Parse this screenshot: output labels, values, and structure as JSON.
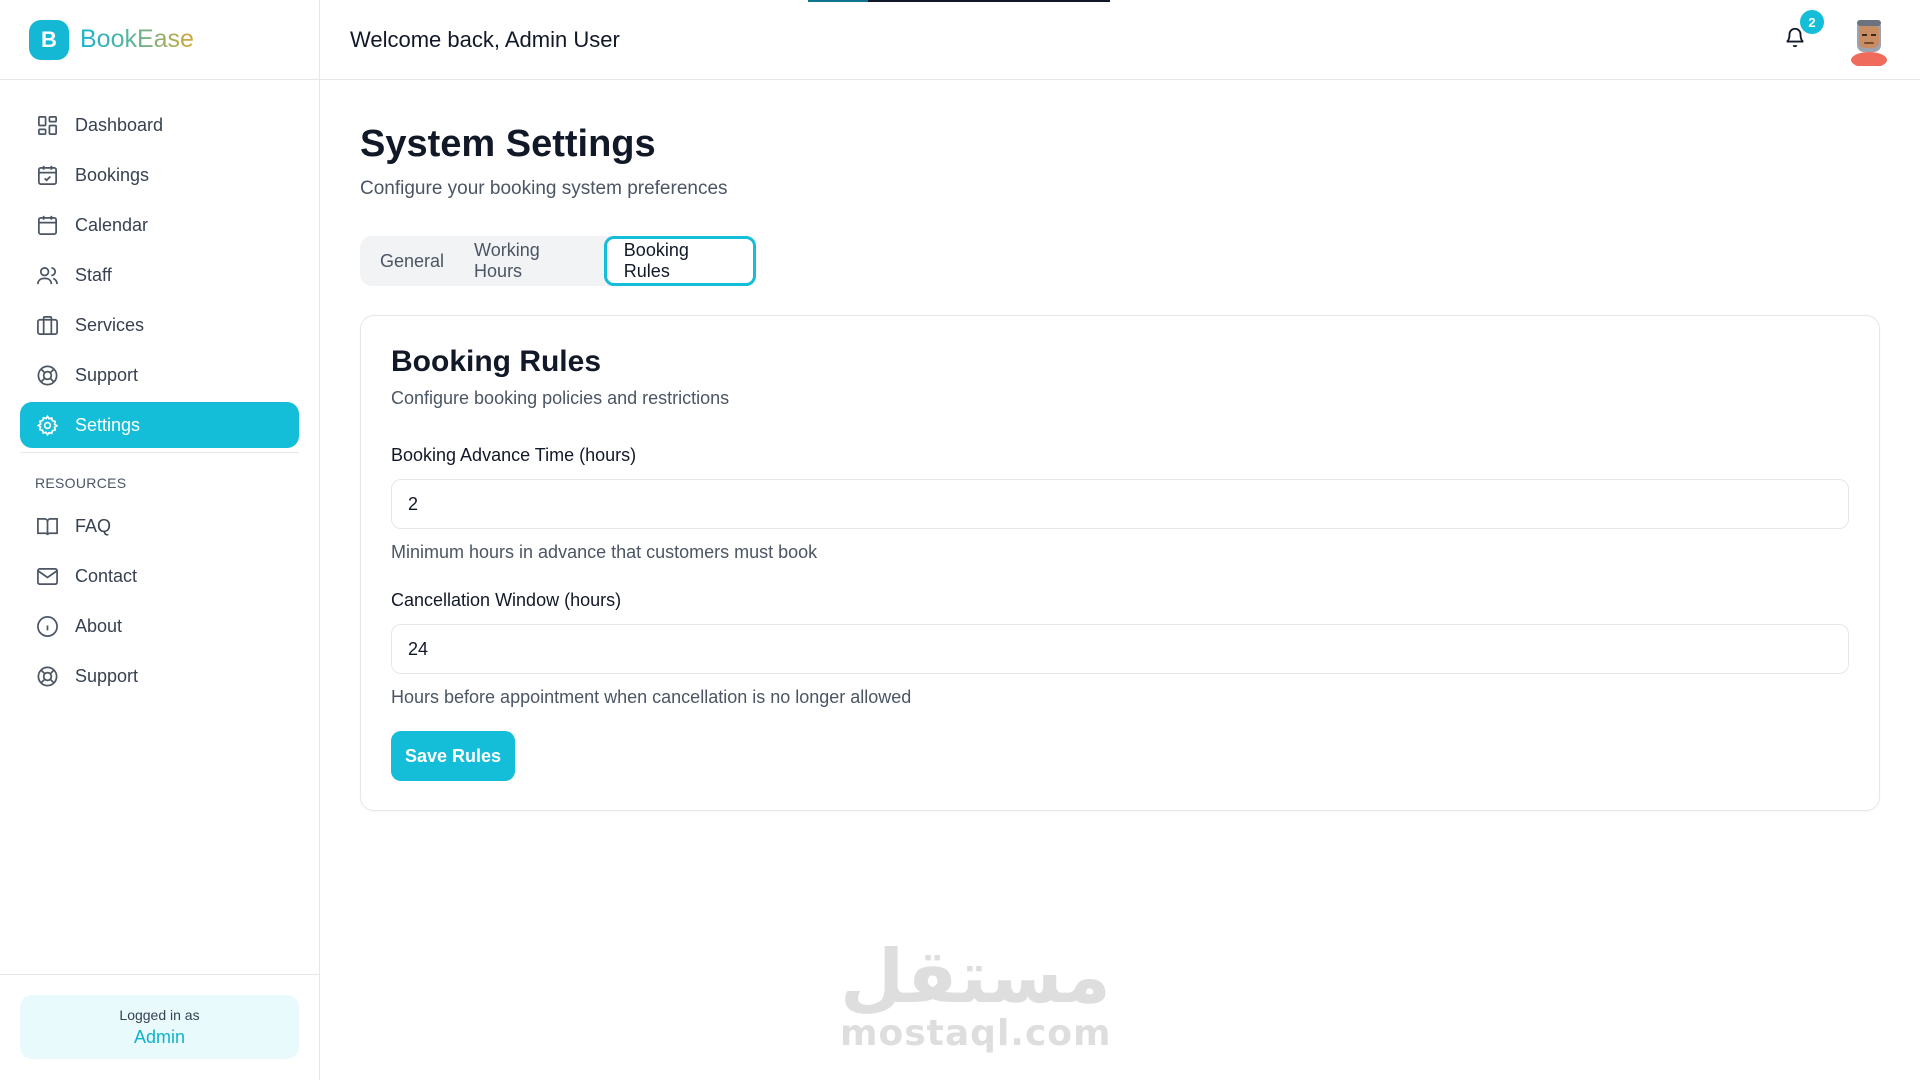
{
  "brand": {
    "logo_letter": "B",
    "name": "BookEase"
  },
  "header": {
    "welcome": "Welcome back, Admin User",
    "notification_count": "2",
    "accent": "#14bdd8"
  },
  "sidebar": {
    "items": [
      {
        "label": "Dashboard",
        "icon": "dashboard-icon"
      },
      {
        "label": "Bookings",
        "icon": "calendar-check-icon"
      },
      {
        "label": "Calendar",
        "icon": "calendar-icon"
      },
      {
        "label": "Staff",
        "icon": "users-icon"
      },
      {
        "label": "Services",
        "icon": "briefcase-icon"
      },
      {
        "label": "Support",
        "icon": "lifebuoy-icon"
      },
      {
        "label": "Settings",
        "icon": "gear-icon",
        "active": true
      }
    ],
    "resources_label": "RESOURCES",
    "resources": [
      {
        "label": "FAQ",
        "icon": "book-open-icon"
      },
      {
        "label": "Contact",
        "icon": "mail-icon"
      },
      {
        "label": "About",
        "icon": "info-icon"
      },
      {
        "label": "Support",
        "icon": "lifebuoy-icon"
      }
    ],
    "footer": {
      "logged_in_label": "Logged in as",
      "user": "Admin"
    }
  },
  "main": {
    "title": "System Settings",
    "subtitle": "Configure your booking system preferences",
    "tabs": [
      {
        "label": "General"
      },
      {
        "label": "Working Hours"
      },
      {
        "label": "Booking Rules",
        "active": true
      }
    ],
    "card": {
      "title": "Booking Rules",
      "subtitle": "Configure booking policies and restrictions",
      "fields": [
        {
          "label": "Booking Advance Time (hours)",
          "value": "2",
          "help": "Minimum hours in advance that customers must book"
        },
        {
          "label": "Cancellation Window (hours)",
          "value": "24",
          "help": "Hours before appointment when cancellation is no longer allowed"
        }
      ],
      "save_label": "Save Rules"
    }
  },
  "watermark": {
    "arabic": "مستقل",
    "latin": "mostaql.com"
  }
}
